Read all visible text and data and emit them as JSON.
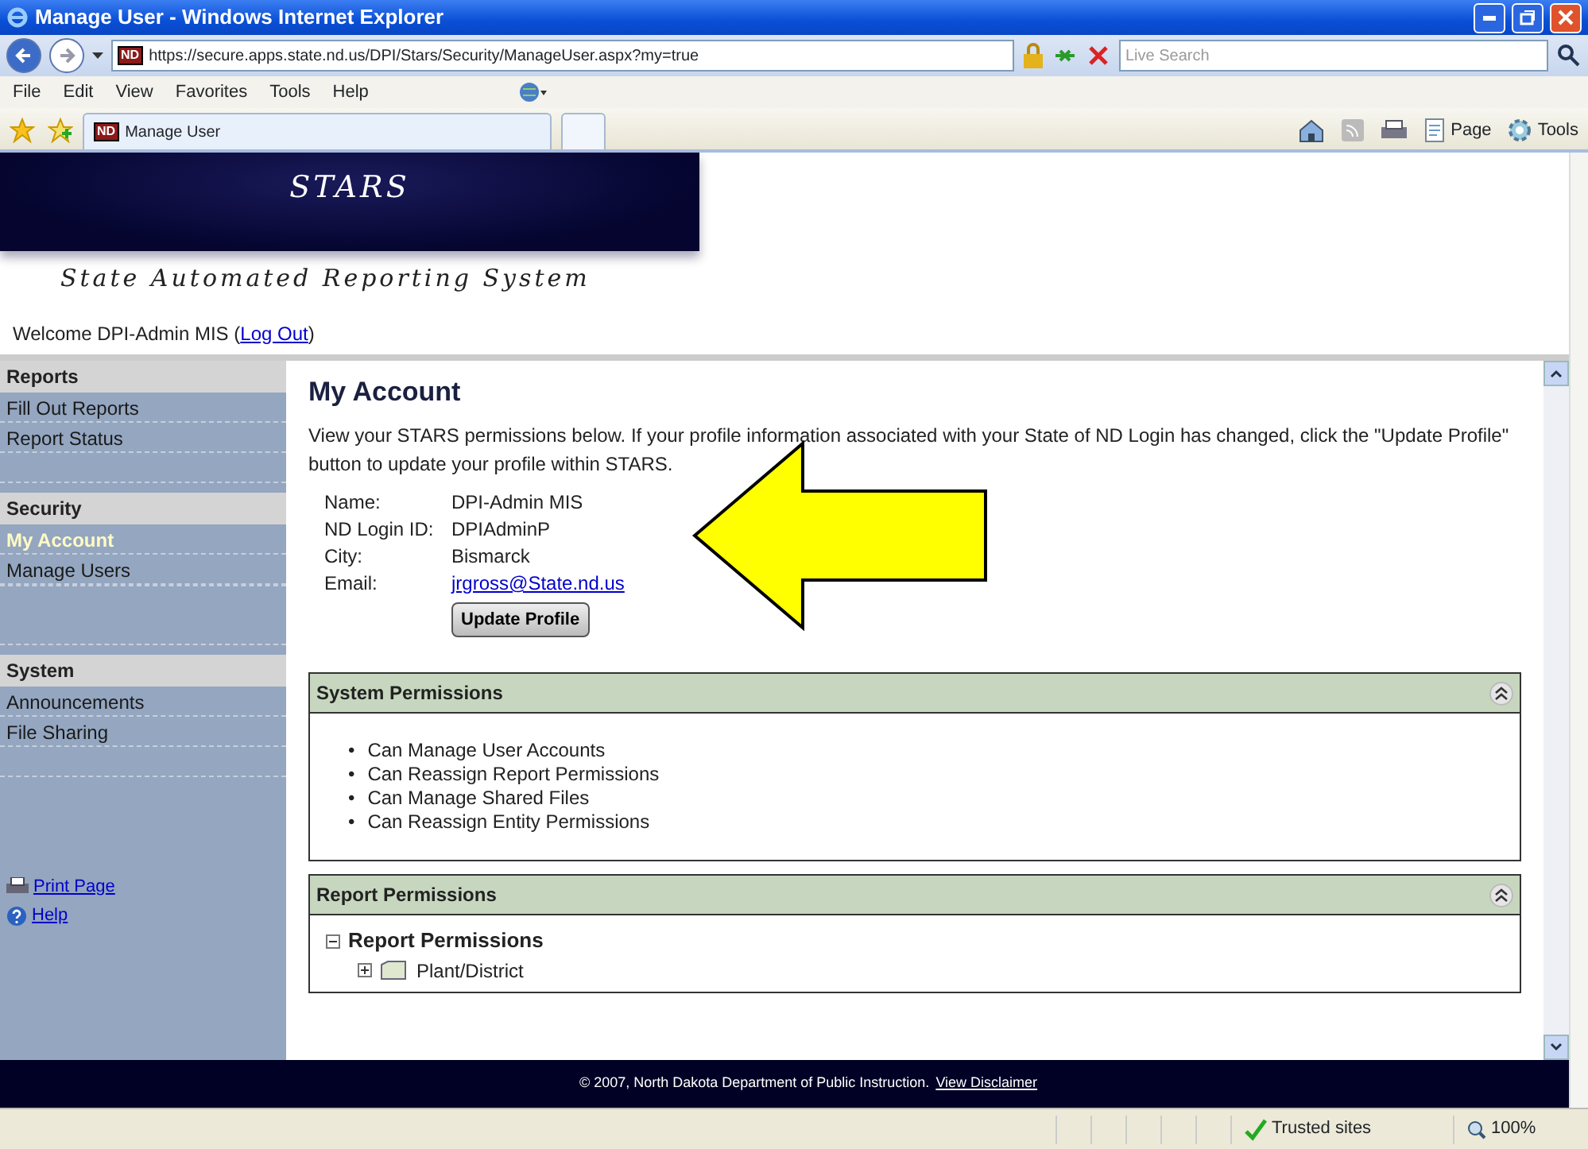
{
  "window": {
    "title": "Manage User - Windows Internet Explorer"
  },
  "address_bar": {
    "site_icon": "ND",
    "url": "https://secure.apps.state.nd.us/DPI/Stars/Security/ManageUser.aspx?my=true",
    "search_placeholder": "Live Search"
  },
  "menu": [
    "File",
    "Edit",
    "View",
    "Favorites",
    "Tools",
    "Help"
  ],
  "tab": {
    "label": "Manage User",
    "site_icon": "ND"
  },
  "command_bar": [
    "Page",
    "Tools"
  ],
  "header": {
    "logo": "STARS",
    "subtitle": "State Automated Reporting System",
    "welcome": "Welcome DPI-Admin MIS (",
    "logout": "Log Out",
    "welcome_end": ")"
  },
  "sidebar": {
    "sections": [
      {
        "title": "Reports",
        "items": [
          {
            "label": "Fill Out Reports",
            "selected": false
          },
          {
            "label": "Report Status",
            "selected": false
          }
        ]
      },
      {
        "title": "Security",
        "items": [
          {
            "label": "My Account",
            "selected": true
          },
          {
            "label": "Manage Users",
            "selected": false
          }
        ]
      },
      {
        "title": "System",
        "items": [
          {
            "label": "Announcements",
            "selected": false
          },
          {
            "label": "File Sharing",
            "selected": false
          }
        ]
      }
    ],
    "links": [
      {
        "kind": "print",
        "label": "Print Page"
      },
      {
        "kind": "help",
        "label": "Help"
      }
    ]
  },
  "content": {
    "heading": "My Account",
    "intro": "View your STARS permissions below. If your profile information associated with your State of ND Login has changed, click the \"Update Profile\" button to update your profile within STARS.",
    "profile": [
      {
        "label": "Name:",
        "value": "DPI-Admin MIS",
        "kind": "text"
      },
      {
        "label": "ND Login ID:",
        "value": "DPIAdminP",
        "kind": "text"
      },
      {
        "label": "City:",
        "value": "Bismarck",
        "kind": "text"
      },
      {
        "label": "Email:",
        "value": "jrgross@State.nd.us",
        "kind": "link"
      }
    ],
    "button": "Update Profile",
    "panels": [
      {
        "title": "System Permissions",
        "kind": "list",
        "marker": "•",
        "items": [
          "Can Manage User Accounts",
          "Can Reassign Report Permissions",
          "Can Manage Shared Files",
          "Can Reassign Entity Permissions"
        ]
      },
      {
        "title": "Report Permissions",
        "kind": "tree",
        "tree": [
          {
            "label": "Report Permissions",
            "expanded": true,
            "children": [
              {
                "label": "Plant/District",
                "expanded": false
              }
            ]
          }
        ]
      }
    ]
  },
  "footer": {
    "text": "© 2007, North Dakota Department of Public Instruction.",
    "link": "View Disclaimer"
  },
  "status_bar": {
    "zone": "Trusted sites",
    "zoom": "100%"
  }
}
